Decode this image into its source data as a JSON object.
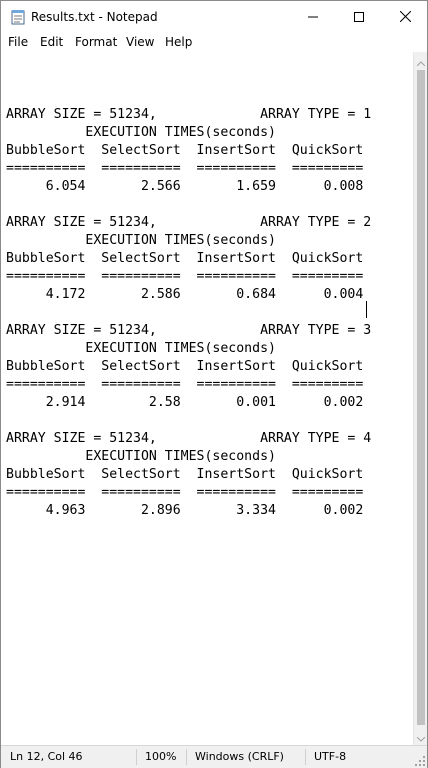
{
  "window": {
    "title": "Results.txt - Notepad",
    "icon": "notepad-icon"
  },
  "controls": {
    "minimize_icon": "minimize-icon",
    "maximize_icon": "maximize-icon",
    "close_icon": "close-icon"
  },
  "menu": {
    "items": [
      "File",
      "Edit",
      "Format",
      "View",
      "Help"
    ]
  },
  "editor": {
    "lines": [
      "",
      "ARRAY SIZE = 51234,             ARRAY TYPE = 1",
      "          EXECUTION TIMES(seconds)",
      "BubbleSort  SelectSort  InsertSort  QuickSort",
      "==========  ==========  ==========  =========",
      "     6.054       2.566       1.659      0.008",
      "",
      "ARRAY SIZE = 51234,             ARRAY TYPE = 2",
      "          EXECUTION TIMES(seconds)",
      "BubbleSort  SelectSort  InsertSort  QuickSort",
      "==========  ==========  ==========  =========",
      "     4.172       2.586       0.684      0.004",
      "",
      "ARRAY SIZE = 51234,             ARRAY TYPE = 3",
      "          EXECUTION TIMES(seconds)",
      "BubbleSort  SelectSort  InsertSort  QuickSort",
      "==========  ==========  ==========  =========",
      "     2.914        2.58       0.001      0.002",
      "",
      "ARRAY SIZE = 51234,             ARRAY TYPE = 4",
      "          EXECUTION TIMES(seconds)",
      "BubbleSort  SelectSort  InsertSort  QuickSort",
      "==========  ==========  ==========  =========",
      "     4.963       2.896       3.334      0.002"
    ]
  },
  "status": {
    "position": "Ln 12, Col 46",
    "zoom": "100%",
    "line_endings": "Windows (CRLF)",
    "encoding": "UTF-8"
  }
}
